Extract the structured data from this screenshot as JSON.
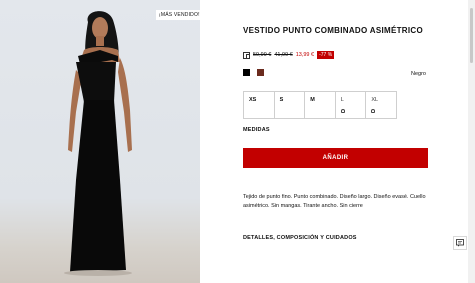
{
  "image": {
    "badge": "¡MÁS VENDIDO!"
  },
  "product": {
    "title": "VESTIDO PUNTO COMBINADO ASIMÉTRICO",
    "price_original": "59,99 €",
    "price_previous": "41,99 €",
    "price_current": "13,99 €",
    "discount": "-77 %",
    "selected_color": "Negro",
    "colors": [
      {
        "name": "black",
        "hex": "#000000"
      },
      {
        "name": "brown",
        "hex": "#6b2b1e"
      }
    ],
    "sizes": [
      {
        "label": "XS",
        "available": true
      },
      {
        "label": "S",
        "available": true
      },
      {
        "label": "M",
        "available": true
      },
      {
        "label": "L",
        "available": false,
        "icon": "bell-icon"
      },
      {
        "label": "XL",
        "available": false,
        "icon": "bell-icon"
      }
    ],
    "measures_label": "MEDIDAS",
    "add_button": "AÑADIR",
    "description": "Tejido de punto fino. Punto combinado. Diseño largo. Diseño evasé. Cuello asimétrico. Sin mangas. Tirante ancho. Sin cierre",
    "details_label": "DETALLES, COMPOSICIÓN Y CUIDADOS"
  },
  "colors": {
    "accent": "#c20000"
  }
}
